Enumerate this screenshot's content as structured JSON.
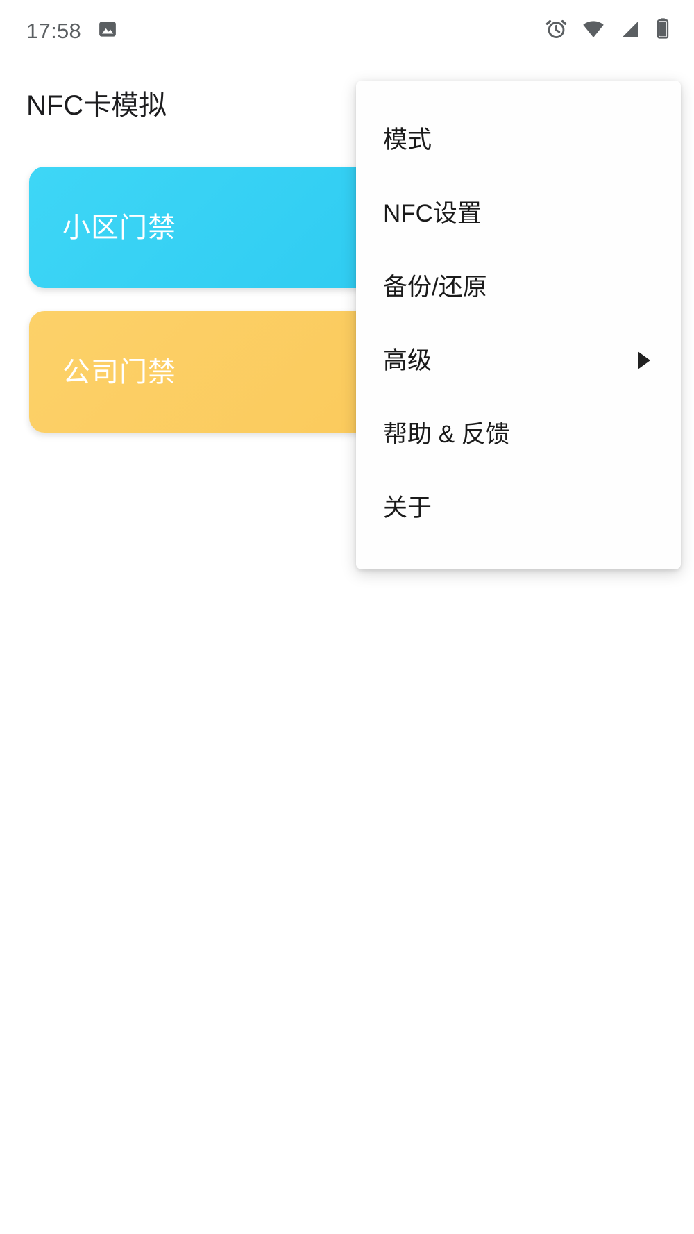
{
  "status_bar": {
    "time": "17:58",
    "left_icons": [
      {
        "name": "photo-notification-icon"
      }
    ],
    "right_icons": [
      {
        "name": "alarm-clock-icon"
      },
      {
        "name": "wifi-icon"
      },
      {
        "name": "cellular-signal-icon"
      },
      {
        "name": "battery-icon"
      }
    ],
    "text_color": "#5b5f62",
    "icon_color": "#5b5f62"
  },
  "app": {
    "title": "NFC卡模拟"
  },
  "cards": [
    {
      "label": "小区门禁",
      "color": "#38d3f4",
      "color_end": "#27c9f0"
    },
    {
      "label": "公司门禁",
      "color": "#fbcd62",
      "color_end": "#f9c34b"
    }
  ],
  "menu": {
    "items": [
      {
        "label": "模式",
        "has_submenu": false
      },
      {
        "label": "NFC设置",
        "has_submenu": false
      },
      {
        "label": "备份/还原",
        "has_submenu": false
      },
      {
        "label": "高级",
        "has_submenu": true
      },
      {
        "label": "帮助 & 反馈",
        "has_submenu": false
      },
      {
        "label": "关于",
        "has_submenu": false
      }
    ],
    "background": "#fefefe"
  }
}
